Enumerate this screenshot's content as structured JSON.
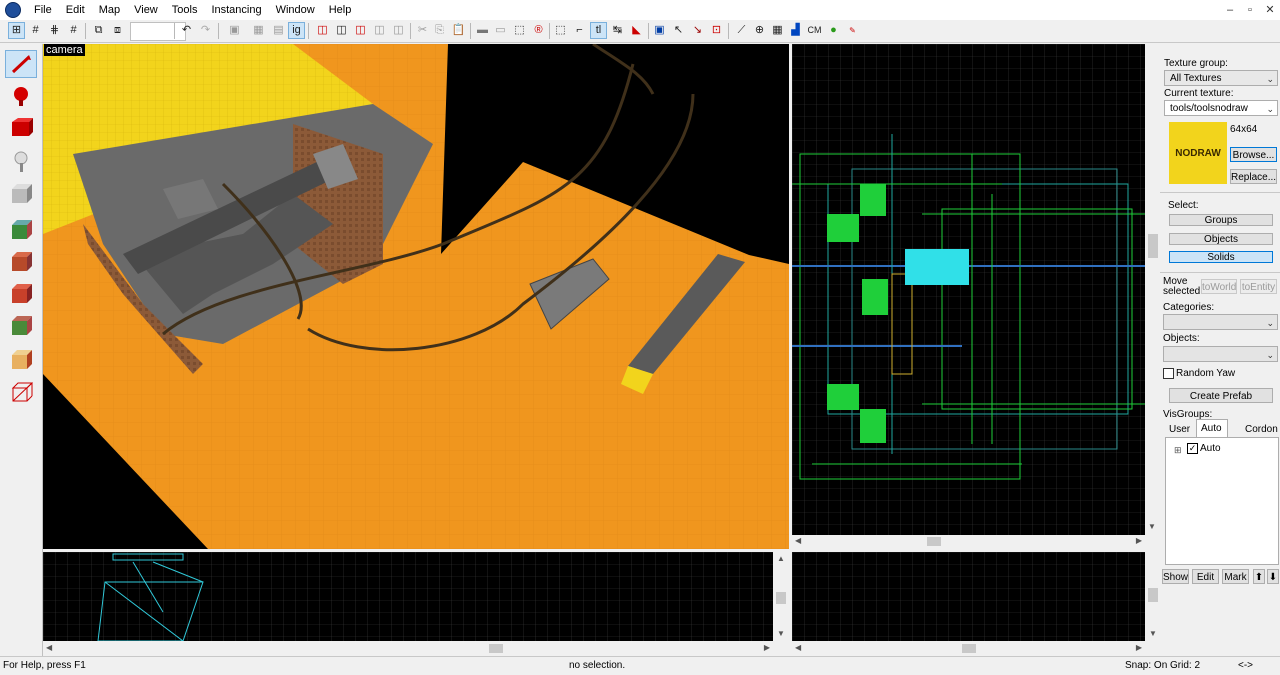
{
  "menu": [
    "File",
    "Edit",
    "Map",
    "View",
    "Tools",
    "Instancing",
    "Window",
    "Help"
  ],
  "window_controls": [
    "–",
    "▫",
    "✕"
  ],
  "viewports": {
    "camera_label": "camera"
  },
  "texture_panel": {
    "texture_group_label": "Texture group:",
    "texture_group_value": "All Textures",
    "current_texture_label": "Current texture:",
    "current_texture_value": "tools/toolsnodraw",
    "texture_preview_text": "NODRAW",
    "texture_size": "64x64",
    "browse_button": "Browse...",
    "replace_button": "Replace..."
  },
  "select_panel": {
    "label": "Select:",
    "groups_button": "Groups",
    "objects_button": "Objects",
    "solids_button": "Solids",
    "active": "Solids"
  },
  "move_panel": {
    "label": "Move selected:",
    "to_world_button": "toWorld",
    "to_entity_button": "toEntity",
    "categories_label": "Categories:",
    "objects_label": "Objects:",
    "random_yaw_label": "Random Yaw",
    "random_yaw_checked": false,
    "create_prefab_button": "Create Prefab"
  },
  "visgroups": {
    "label": "VisGroups:",
    "tabs": [
      "User",
      "Auto",
      "Cordon"
    ],
    "active_tab": "Auto",
    "tree_item": "Auto",
    "tree_item_checked": true,
    "show_button": "Show",
    "edit_button": "Edit",
    "mark_button": "Mark",
    "up_arrow": "⬆",
    "down_arrow": "⬇"
  },
  "status": {
    "help": "For Help, press F1",
    "selection": "no selection.",
    "snap": "Snap: On Grid: 2",
    "extra": "<->"
  },
  "colors": {
    "floor_orange": "#f0961e",
    "texture_yellow": "#f2d41c",
    "grid_line": "#3a3a3a",
    "brush_green": "#1fcf3a",
    "brush_cyan": "#30e0e8",
    "selected_button": "#cce4f7"
  }
}
